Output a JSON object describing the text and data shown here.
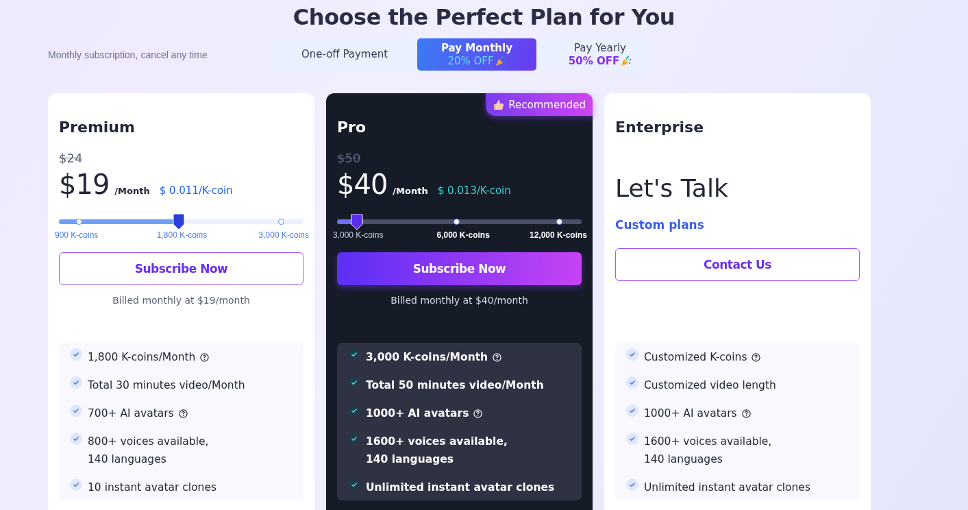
{
  "title": "Choose the Perfect Plan for You",
  "subtitle": "Monthly subscription, cancel any time",
  "billing_tabs": [
    {
      "label": "One-off Payment",
      "selected": false
    },
    {
      "label": "Pay Monthly",
      "discount": "20% OFF",
      "selected": true
    },
    {
      "label": "Pay Yearly",
      "discount": "50% OFF",
      "selected": false
    }
  ],
  "plans": [
    {
      "kind": "priced",
      "featured": false,
      "name": "Premium",
      "old_price": "$24",
      "price": "$19",
      "period": "/Month",
      "unit_price": "$ 0.011/K-coin",
      "slider": {
        "level": 0.49,
        "stops": [
          {
            "label": "900 K-coins"
          },
          {
            "label": "1,800 K-coins"
          },
          {
            "label": "3,000 K-coins"
          }
        ]
      },
      "button": "Subscribe Now",
      "note": "Billed monthly at $19/month",
      "features": [
        {
          "lines": [
            "1,800 K-coins/Month"
          ],
          "help": true
        },
        {
          "lines": [
            "Total 30 minutes video/Month"
          ],
          "help": false
        },
        {
          "lines": [
            "700+ AI avatars"
          ],
          "help": true
        },
        {
          "lines": [
            "800+ voices available,",
            "140 languages"
          ],
          "help": false
        },
        {
          "lines": [
            "10 instant avatar clones"
          ],
          "help": false
        }
      ]
    },
    {
      "kind": "priced",
      "featured": true,
      "badge": "Recommended",
      "name": "Pro",
      "old_price": "$50",
      "price": "$40",
      "period": "/Month",
      "unit_price": "$ 0.013/K-coin",
      "slider": {
        "level": 0.08,
        "stops": [
          {
            "label": "3,000 K-coins"
          },
          {
            "label": "6,000 K-coins"
          },
          {
            "label": "12,000 K-coins"
          }
        ]
      },
      "button": "Subscribe Now",
      "note": "Billed monthly at $40/month",
      "features": [
        {
          "lines": [
            "3,000 K-coins/Month"
          ],
          "help": true
        },
        {
          "lines": [
            "Total 50 minutes video/Month"
          ],
          "help": false
        },
        {
          "lines": [
            "1000+ AI avatars"
          ],
          "help": true
        },
        {
          "lines": [
            "1600+ voices available,",
            "140 languages"
          ],
          "help": false
        },
        {
          "lines": [
            "Unlimited instant avatar clones"
          ],
          "help": false
        }
      ]
    },
    {
      "kind": "contact",
      "featured": false,
      "name": "Enterprise",
      "headline": "Let's Talk",
      "link": "Custom plans",
      "button": "Contact Us",
      "features": [
        {
          "lines": [
            "Customized K-coins"
          ],
          "help": true
        },
        {
          "lines": [
            "Customized video length"
          ],
          "help": false
        },
        {
          "lines": [
            "1000+ AI avatars"
          ],
          "help": true
        },
        {
          "lines": [
            "1600+ voices available,",
            "140 languages"
          ],
          "help": false
        },
        {
          "lines": [
            "Unlimited instant avatar clones"
          ],
          "help": false
        }
      ]
    }
  ]
}
